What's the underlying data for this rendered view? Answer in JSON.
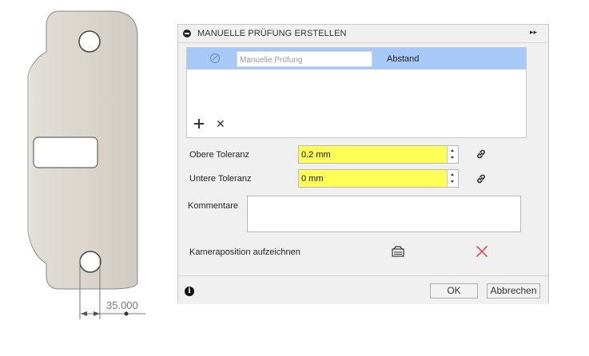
{
  "canvas": {
    "dimension_value": "35.000"
  },
  "dialog": {
    "title": "MANUELLE PRÜFUNG ERSTELLEN",
    "expand_glyph": "▸▸",
    "list": {
      "rows": [
        {
          "name_placeholder": "Manuelle Prüfung",
          "type": "Abstand",
          "selected": true
        }
      ],
      "add_glyph": "",
      "remove_glyph": "✕"
    },
    "upper_tolerance": {
      "label": "Obere Toleranz",
      "value": "0.2 mm"
    },
    "lower_tolerance": {
      "label": "Untere Toleranz",
      "value": "0 mm"
    },
    "comments": {
      "label": "Kommentare",
      "value": ""
    },
    "camera": {
      "label": "Kameraposition aufzeichnen"
    },
    "footer": {
      "info_glyph": "i",
      "ok_label": "OK",
      "cancel_label": "Abbrechen"
    }
  },
  "colors": {
    "selection": "#a8c8f8",
    "input_highlight": "#ffff55",
    "delete_red": "#e05050",
    "part_fill": "#dcd8d0"
  }
}
